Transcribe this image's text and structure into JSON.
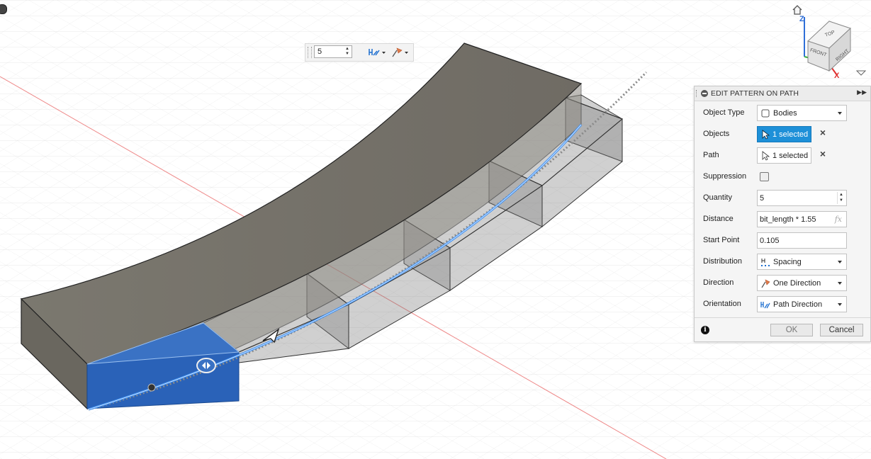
{
  "mini_toolbar": {
    "quantity": "5"
  },
  "viewcube": {
    "top": "TOP",
    "front": "FRONT",
    "right": "RIGHT",
    "axis_z": "Z",
    "axis_x": "X"
  },
  "panel": {
    "title": "EDIT PATTERN ON PATH",
    "rows": {
      "object_type": {
        "label": "Object Type",
        "value": "Bodies"
      },
      "objects": {
        "label": "Objects",
        "value": "1 selected"
      },
      "path": {
        "label": "Path",
        "value": "1 selected"
      },
      "suppression": {
        "label": "Suppression"
      },
      "quantity": {
        "label": "Quantity",
        "value": "5"
      },
      "distance": {
        "label": "Distance",
        "value": "bit_length * 1.55",
        "fx": "fx"
      },
      "start_point": {
        "label": "Start Point",
        "value": "0.105"
      },
      "distribution": {
        "label": "Distribution",
        "value": "Spacing"
      },
      "direction": {
        "label": "Direction",
        "value": "One Direction"
      },
      "orientation": {
        "label": "Orientation",
        "value": "Path Direction"
      }
    },
    "ok_label": "OK",
    "cancel_label": "Cancel"
  },
  "colors": {
    "accent": "#1e90d8",
    "selected_body": "#2a62b8",
    "body": "#7a7670"
  }
}
